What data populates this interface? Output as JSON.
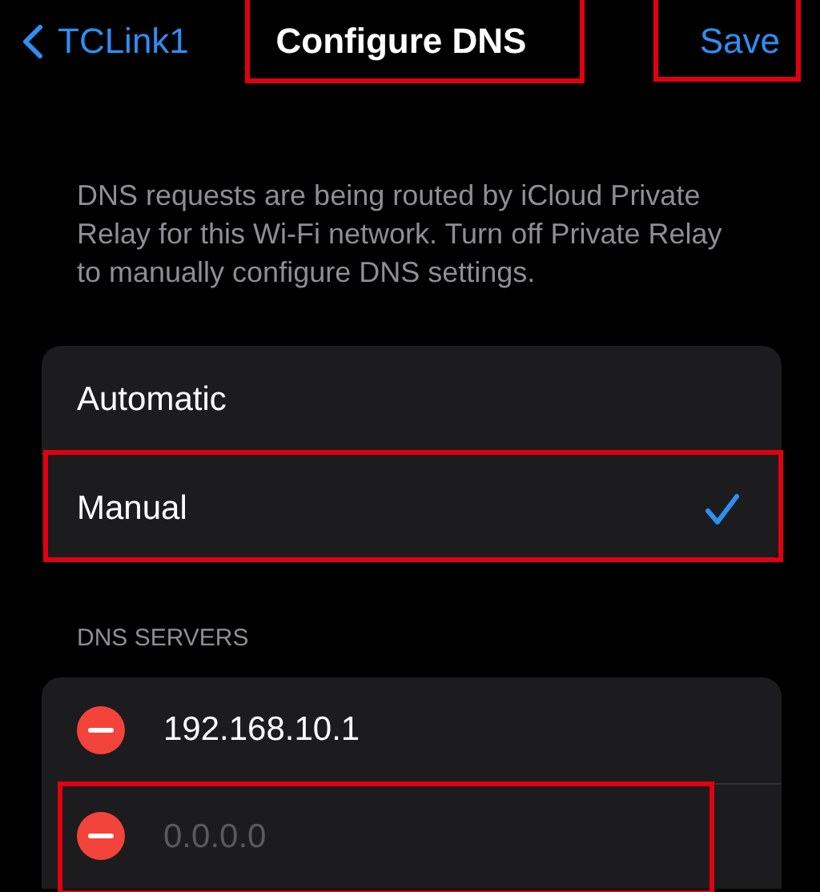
{
  "nav": {
    "back_label": "TCLink1",
    "title": "Configure DNS",
    "title_highlighted": true,
    "save_label": "Save",
    "save_highlighted": true
  },
  "footnote": "DNS requests are being routed by iCloud Private Relay for this Wi-Fi network. Turn off Private Relay to manually configure DNS settings.",
  "modes": [
    {
      "label": "Automatic",
      "selected": false,
      "highlighted": false
    },
    {
      "label": "Manual",
      "selected": true,
      "highlighted": true
    }
  ],
  "servers_header": "DNS SERVERS",
  "servers": [
    {
      "value": "192.168.10.1",
      "highlighted": false
    },
    {
      "placeholder": "0.0.0.0",
      "highlighted": true
    }
  ]
}
